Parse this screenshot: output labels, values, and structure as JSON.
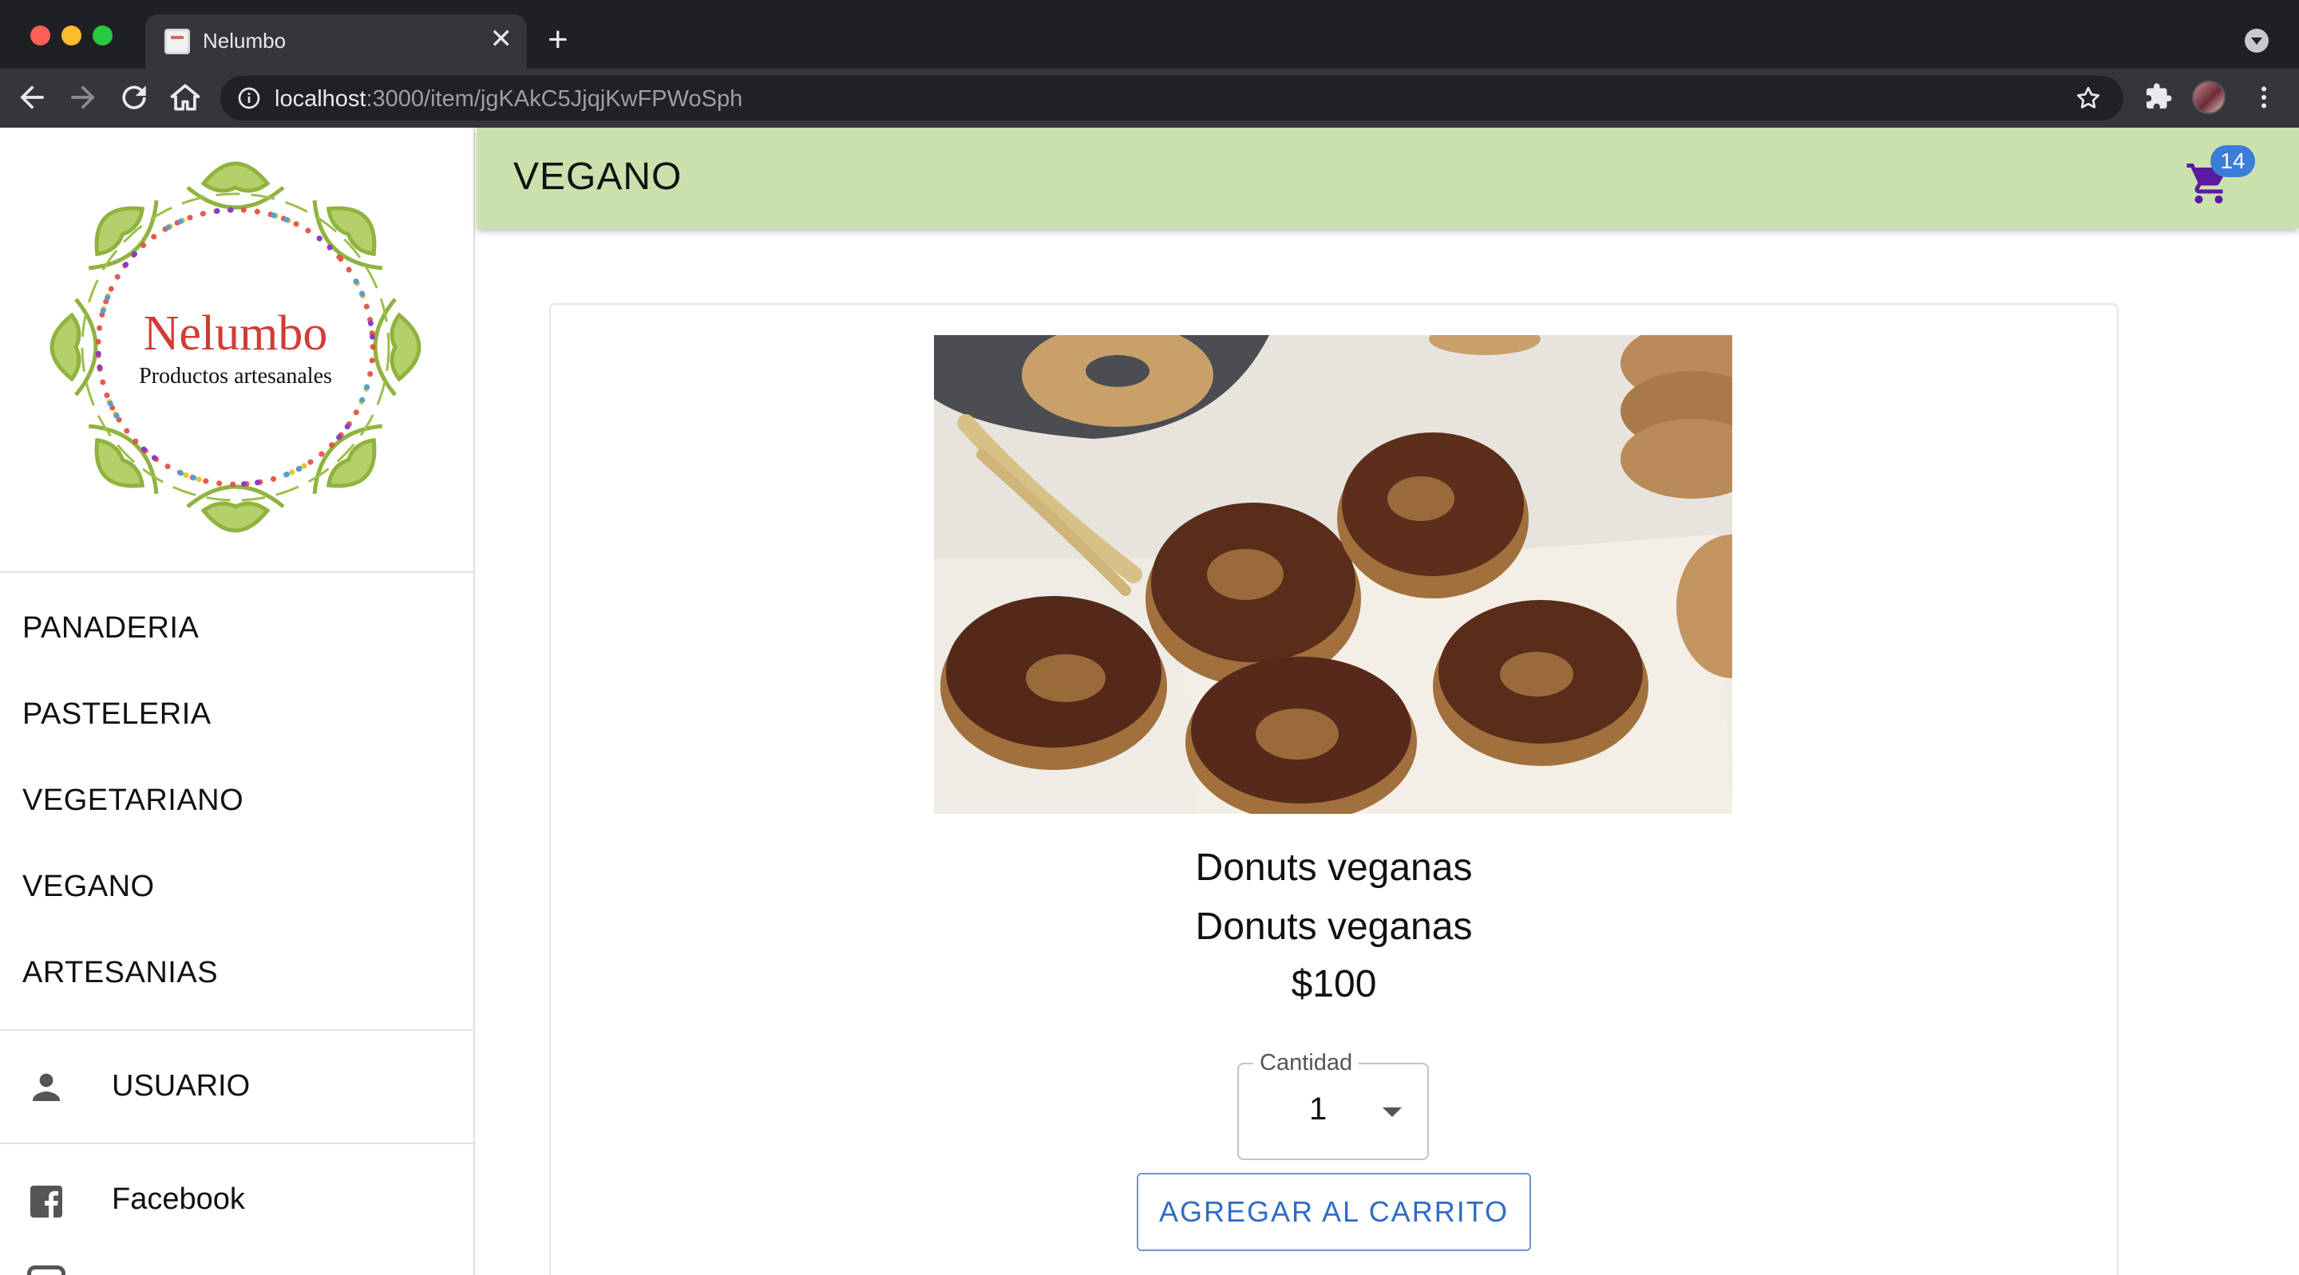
{
  "browser": {
    "tab_title": "Nelumbo",
    "tab_close": "✕",
    "new_tab": "+",
    "url_host": "localhost",
    "url_rest": ":3000/item/jgKAkC5JjqjKwFPWoSph"
  },
  "logo": {
    "brand": "Nelumbo",
    "tagline": "Productos artesanales"
  },
  "sidebar": {
    "categories": [
      "PANADERIA",
      "PASTELERIA",
      "VEGETARIANO",
      "VEGANO",
      "ARTESANIAS"
    ],
    "user_label": "USUARIO",
    "facebook_label": "Facebook"
  },
  "header": {
    "title": "VEGANO",
    "cart_count": "14"
  },
  "product": {
    "name": "Donuts veganas",
    "description": "Donuts veganas",
    "price": "$100",
    "quantity_label": "Cantidad",
    "quantity_value": "1",
    "add_button": "AGREGAR AL CARRITO"
  },
  "colors": {
    "appbar": "#cbe1ad",
    "cart_icon": "#5b1aa0",
    "badge": "#3b7dd8",
    "button_text": "#2f6cc4",
    "logo_text": "#d23b35"
  }
}
